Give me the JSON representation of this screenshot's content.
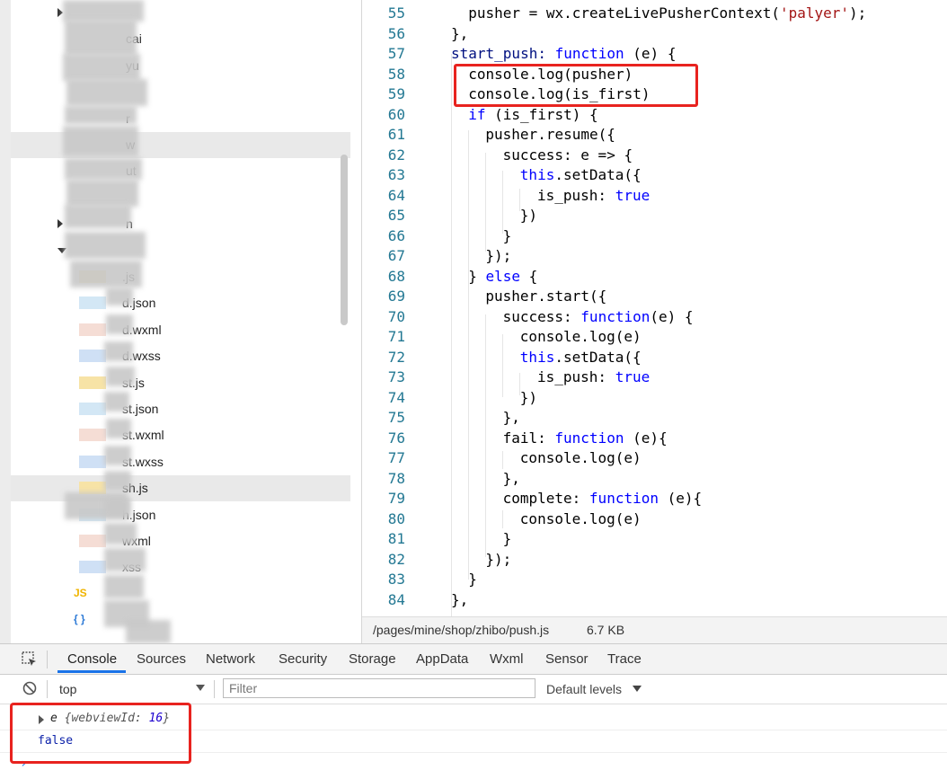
{
  "file_tree": {
    "rows": [
      {
        "label": "",
        "indent": 0,
        "arrow": "right"
      },
      {
        "label": "cai"
      },
      {
        "label": "yu"
      },
      {
        "label": ""
      },
      {
        "label": "r"
      },
      {
        "label": "w",
        "highlighted": true
      },
      {
        "label": "ut"
      },
      {
        "label": ""
      },
      {
        "label": "n",
        "arrow": "right"
      },
      {
        "label": "",
        "arrow": "down"
      },
      {
        "label": ".js",
        "icon": "js"
      },
      {
        "label": "d.json",
        "icon": "json"
      },
      {
        "label": "d.wxml",
        "icon": "wxml"
      },
      {
        "label": "d.wxss",
        "icon": "wxss"
      },
      {
        "label": "st.js",
        "icon": "js"
      },
      {
        "label": "st.json",
        "icon": "json"
      },
      {
        "label": "st.wxml",
        "icon": "wxml"
      },
      {
        "label": "st.wxss",
        "icon": "wxss"
      },
      {
        "label": "sh.js",
        "icon": "js",
        "highlighted": true
      },
      {
        "label": "h.json",
        "icon": "json"
      },
      {
        "label": "wxml",
        "icon": "wxml"
      },
      {
        "label": "xss",
        "icon": "wxss"
      },
      {
        "label": "JS",
        "icon": "js-badge"
      },
      {
        "label": "{ }",
        "icon": "json-badge"
      }
    ]
  },
  "editor": {
    "lines": [
      {
        "n": "55",
        "ind": 1,
        "tokens": [
          [
            "pusher = wx.createLivePusherContext(",
            ""
          ],
          [
            "'palyer'",
            "str"
          ],
          [
            ");",
            ""
          ]
        ]
      },
      {
        "n": "56",
        "ind": 0,
        "tokens": [
          [
            "},",
            ""
          ]
        ]
      },
      {
        "n": "57",
        "ind": 0,
        "tokens": [
          [
            "start_push: ",
            "prop"
          ],
          [
            "function",
            "kw"
          ],
          [
            " (e) {",
            ""
          ]
        ]
      },
      {
        "n": "58",
        "ind": 1,
        "tokens": [
          [
            "console.log(pusher)",
            ""
          ]
        ]
      },
      {
        "n": "59",
        "ind": 1,
        "tokens": [
          [
            "console.log(is_first)",
            ""
          ]
        ]
      },
      {
        "n": "60",
        "ind": 1,
        "tokens": [
          [
            "if",
            "kw"
          ],
          [
            " (is_first) {",
            ""
          ]
        ]
      },
      {
        "n": "61",
        "ind": 2,
        "tokens": [
          [
            "pusher.resume({",
            ""
          ]
        ]
      },
      {
        "n": "62",
        "ind": 3,
        "tokens": [
          [
            "success: e => {",
            ""
          ]
        ]
      },
      {
        "n": "63",
        "ind": 4,
        "tokens": [
          [
            "this",
            "kw"
          ],
          [
            ".setData({",
            ""
          ]
        ]
      },
      {
        "n": "64",
        "ind": 5,
        "tokens": [
          [
            "is_push: ",
            ""
          ],
          [
            "true",
            "kw"
          ]
        ]
      },
      {
        "n": "65",
        "ind": 4,
        "tokens": [
          [
            "})",
            ""
          ]
        ]
      },
      {
        "n": "66",
        "ind": 3,
        "tokens": [
          [
            "}",
            ""
          ]
        ]
      },
      {
        "n": "67",
        "ind": 2,
        "tokens": [
          [
            "});",
            ""
          ]
        ]
      },
      {
        "n": "68",
        "ind": 1,
        "tokens": [
          [
            "} ",
            ""
          ],
          [
            "else",
            "kw"
          ],
          [
            " {",
            ""
          ]
        ]
      },
      {
        "n": "69",
        "ind": 2,
        "tokens": [
          [
            "pusher.start({",
            ""
          ]
        ]
      },
      {
        "n": "70",
        "ind": 3,
        "tokens": [
          [
            "success: ",
            ""
          ],
          [
            "function",
            "kw"
          ],
          [
            "(e) {",
            ""
          ]
        ]
      },
      {
        "n": "71",
        "ind": 4,
        "tokens": [
          [
            "console.log(e)",
            ""
          ]
        ]
      },
      {
        "n": "72",
        "ind": 4,
        "tokens": [
          [
            "this",
            "kw"
          ],
          [
            ".setData({",
            ""
          ]
        ]
      },
      {
        "n": "73",
        "ind": 5,
        "tokens": [
          [
            "is_push: ",
            ""
          ],
          [
            "true",
            "kw"
          ]
        ]
      },
      {
        "n": "74",
        "ind": 4,
        "tokens": [
          [
            "})",
            ""
          ]
        ]
      },
      {
        "n": "75",
        "ind": 3,
        "tokens": [
          [
            "},",
            ""
          ]
        ]
      },
      {
        "n": "76",
        "ind": 3,
        "tokens": [
          [
            "fail: ",
            ""
          ],
          [
            "function",
            "kw"
          ],
          [
            " (e){",
            ""
          ]
        ]
      },
      {
        "n": "77",
        "ind": 4,
        "tokens": [
          [
            "console.log(e)",
            ""
          ]
        ]
      },
      {
        "n": "78",
        "ind": 3,
        "tokens": [
          [
            "},",
            ""
          ]
        ]
      },
      {
        "n": "79",
        "ind": 3,
        "tokens": [
          [
            "complete: ",
            ""
          ],
          [
            "function",
            "kw"
          ],
          [
            " (e){",
            ""
          ]
        ]
      },
      {
        "n": "80",
        "ind": 4,
        "tokens": [
          [
            "console.log(e)",
            ""
          ]
        ]
      },
      {
        "n": "81",
        "ind": 3,
        "tokens": [
          [
            "}",
            ""
          ]
        ]
      },
      {
        "n": "82",
        "ind": 2,
        "tokens": [
          [
            "});",
            ""
          ]
        ]
      },
      {
        "n": "83",
        "ind": 1,
        "tokens": [
          [
            "}",
            ""
          ]
        ]
      },
      {
        "n": "84",
        "ind": 0,
        "tokens": [
          [
            "},",
            ""
          ]
        ]
      }
    ]
  },
  "status": {
    "path": "/pages/mine/shop/zhibo/push.js",
    "size": "6.7 KB"
  },
  "devtools": {
    "tabs": [
      "Console",
      "Sources",
      "Network",
      "Security",
      "Storage",
      "AppData",
      "Wxml",
      "Sensor",
      "Trace"
    ],
    "active_tab": "Console",
    "context": "top",
    "filter_placeholder": "Filter",
    "levels": "Default levels",
    "logs": [
      {
        "text": "e {webviewId: 16}",
        "prefix": "e ",
        "obj": "{webviewId: ",
        "num": "16",
        "suffix": "}",
        "expandable": true
      },
      {
        "text": "false",
        "type": "boolean"
      }
    ],
    "prompt": "›"
  },
  "colors": {
    "keyword": "#0000ff",
    "string": "#a31515",
    "line_number": "#237893",
    "annotation_box": "#e8231f",
    "active_tab_underline": "#1a73e8"
  }
}
